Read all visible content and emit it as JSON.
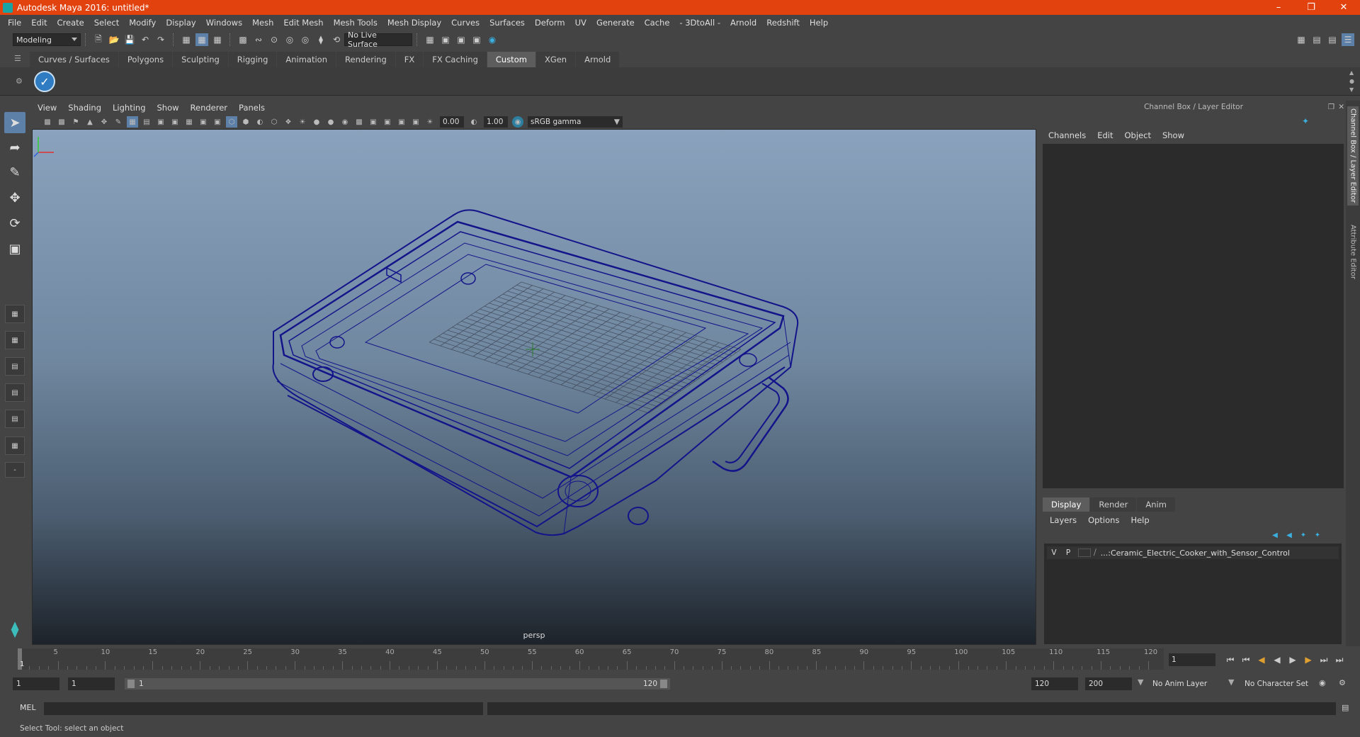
{
  "window": {
    "title": "Autodesk Maya 2016: untitled*"
  },
  "menus": [
    "File",
    "Edit",
    "Create",
    "Select",
    "Modify",
    "Display",
    "Windows",
    "Mesh",
    "Edit Mesh",
    "Mesh Tools",
    "Mesh Display",
    "Curves",
    "Surfaces",
    "Deform",
    "UV",
    "Generate",
    "Cache",
    "- 3DtoAll -",
    "Arnold",
    "Redshift",
    "Help"
  ],
  "statusline": {
    "mode": "Modeling",
    "live_surface": "No Live Surface"
  },
  "shelf": {
    "tabs": [
      "Curves / Surfaces",
      "Polygons",
      "Sculpting",
      "Rigging",
      "Animation",
      "Rendering",
      "FX",
      "FX Caching",
      "Custom",
      "XGen",
      "Arnold"
    ],
    "active_tab": "Custom"
  },
  "viewport": {
    "menus": [
      "View",
      "Shading",
      "Lighting",
      "Show",
      "Renderer",
      "Panels"
    ],
    "exposure": "0.00",
    "gamma": "1.00",
    "color_space": "sRGB gamma",
    "camera_label": "persp",
    "wire_color": "#14148a"
  },
  "channel_box": {
    "title": "Channel Box / Layer Editor",
    "menus": [
      "Channels",
      "Edit",
      "Object",
      "Show"
    ]
  },
  "layer_editor": {
    "tabs": [
      "Display",
      "Render",
      "Anim"
    ],
    "active_tab": "Display",
    "menus": [
      "Layers",
      "Options",
      "Help"
    ],
    "layer": {
      "v": "V",
      "p": "P",
      "name": "...:Ceramic_Electric_Cooker_with_Sensor_Control"
    }
  },
  "side_tabs": [
    "Channel Box / Layer Editor",
    "Attribute Editor"
  ],
  "timeslider": {
    "ticks": [
      "5",
      "10",
      "15",
      "20",
      "25",
      "30",
      "35",
      "40",
      "45",
      "50",
      "55",
      "60",
      "65",
      "70",
      "75",
      "80",
      "85",
      "90",
      "95",
      "100",
      "105",
      "110",
      "115",
      "120"
    ],
    "current": "1",
    "current_frame_field": "1"
  },
  "range": {
    "start": "1",
    "playback_start": "1",
    "slider_start": "1",
    "slider_end": "120",
    "playback_end": "120",
    "end": "200",
    "anim_layer": "No Anim Layer",
    "character_set": "No Character Set"
  },
  "cmdline": {
    "label": "MEL"
  },
  "helpline": {
    "text": "Select Tool: select an object"
  }
}
